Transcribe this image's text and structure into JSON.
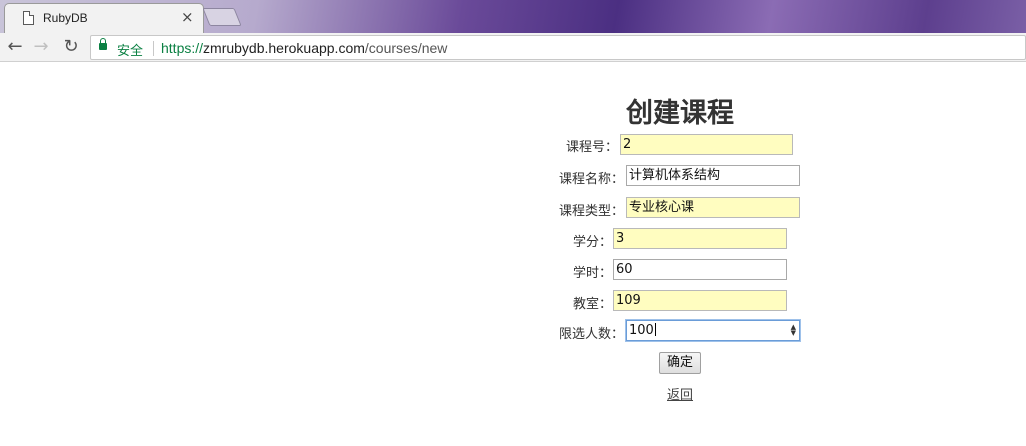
{
  "browser": {
    "tab_title": "RubyDB",
    "tab_close": "×",
    "back_icon": "←",
    "forward_icon": "→",
    "reload_icon": "↻",
    "secure_label": "安全",
    "url_scheme": "https://",
    "url_host": "zmrubydb.herokuapp.com",
    "url_path": "/courses/new"
  },
  "form": {
    "title": "创建课程",
    "fields": {
      "course_no": {
        "label": "课程号：",
        "value": "2"
      },
      "course_name": {
        "label": "课程名称：",
        "value": "计算机体系结构"
      },
      "course_type": {
        "label": "课程类型：",
        "value": "专业核心课"
      },
      "credit": {
        "label": "学分：",
        "value": "3"
      },
      "hours": {
        "label": "学时：",
        "value": "60"
      },
      "classroom": {
        "label": "教室：",
        "value": "109"
      },
      "limit": {
        "label": "限选人数：",
        "value": "100"
      }
    },
    "submit_label": "确定",
    "back_link": "返回"
  },
  "colors": {
    "secure_green": "#0b8043",
    "autofill_yellow": "#fffdc0",
    "focus_blue": "#6a9cd8"
  }
}
